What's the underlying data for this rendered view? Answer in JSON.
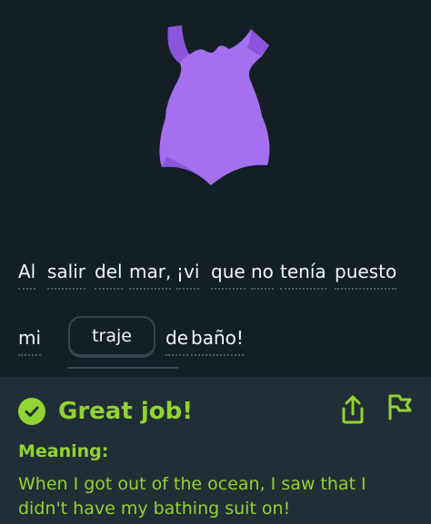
{
  "sentence": {
    "line1": [
      "Al",
      "salir",
      "del",
      "mar,",
      "¡vi",
      "que",
      "no",
      "tenía",
      "puesto"
    ],
    "line2_before": "mi",
    "selected_word": "traje",
    "line2_after": [
      "de",
      "baño!"
    ]
  },
  "feedback": {
    "title": "Great job!",
    "meaning_label": "Meaning:",
    "meaning_text": "When I got out of the ocean, I saw that I didn't have my bathing suit on!"
  },
  "colors": {
    "background": "#131f24",
    "feedback_bg": "#202f36",
    "accent_green": "#93d333",
    "swimsuit": "#a570f0"
  },
  "icons": {
    "illustration": "swimsuit",
    "status": "check-circle-icon",
    "share": "share-icon",
    "report": "flag-icon"
  }
}
